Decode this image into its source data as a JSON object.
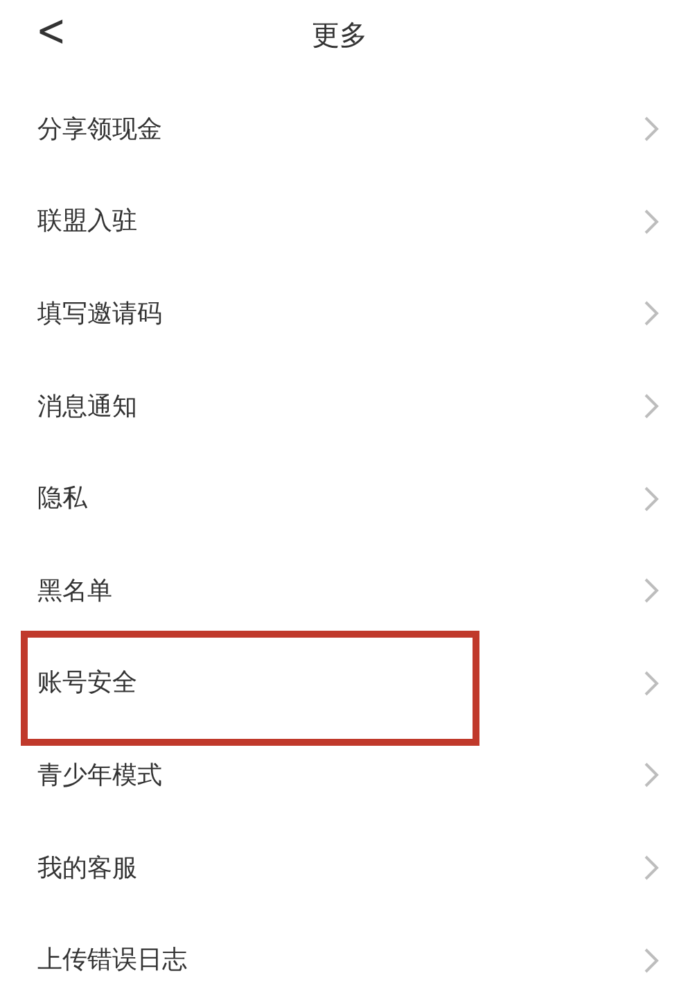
{
  "header": {
    "back": "<",
    "title": "更多"
  },
  "items": [
    {
      "label": "分享领现金",
      "highlighted": false
    },
    {
      "label": "联盟入驻",
      "highlighted": false
    },
    {
      "label": "填写邀请码",
      "highlighted": false
    },
    {
      "label": "消息通知",
      "highlighted": false
    },
    {
      "label": "隐私",
      "highlighted": false
    },
    {
      "label": "黑名单",
      "highlighted": false
    },
    {
      "label": "账号安全",
      "highlighted": true
    },
    {
      "label": "青少年模式",
      "highlighted": false
    },
    {
      "label": "我的客服",
      "highlighted": false
    },
    {
      "label": "上传错误日志",
      "highlighted": false
    }
  ]
}
